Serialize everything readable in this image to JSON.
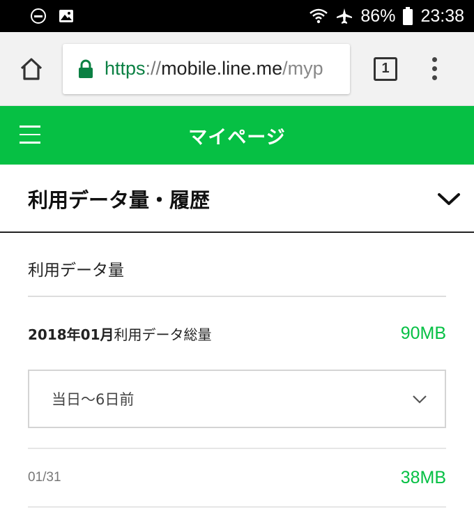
{
  "status_bar": {
    "battery": "86%",
    "time": "23:38"
  },
  "browser": {
    "url_scheme": "https",
    "url_sep": "://",
    "url_host": "mobile.line.me",
    "url_path": "/myp",
    "tab_count": "1"
  },
  "header": {
    "title": "マイページ"
  },
  "section": {
    "title": "利用データ量・履歴"
  },
  "usage": {
    "subtitle": "利用データ量",
    "month_bold": "2018年01月",
    "month_label": "利用データ総量",
    "month_total": "90MB",
    "range_selected": "当日〜6日前",
    "rows": [
      {
        "date": "01/31",
        "amount": "38MB"
      }
    ]
  },
  "colors": {
    "brand_green": "#06c044",
    "secure_green": "#0b8043"
  }
}
